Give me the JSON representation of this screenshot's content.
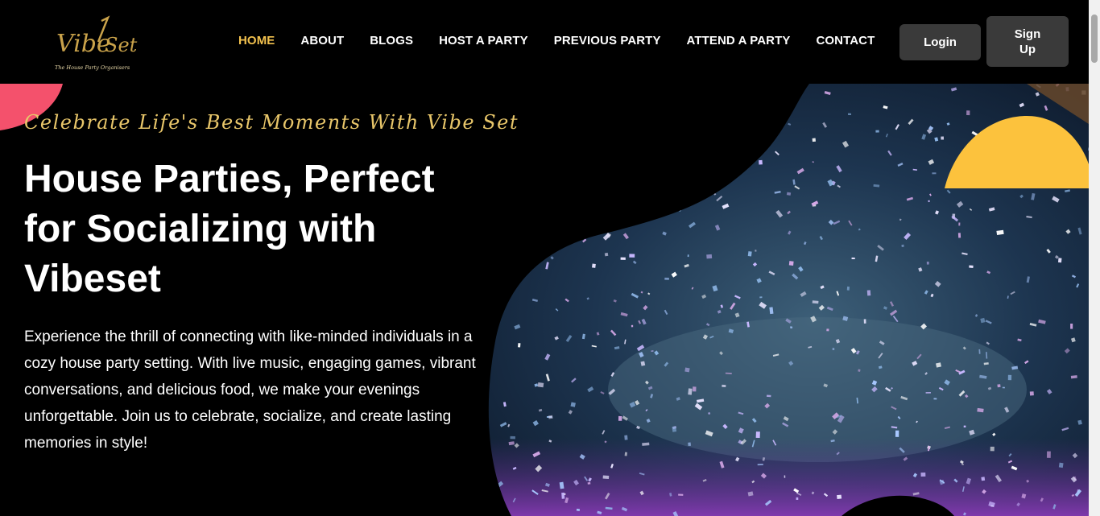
{
  "brand": {
    "logo_text": "VibeSet",
    "logo_tagline": "The House Party Organisers"
  },
  "nav": {
    "items": [
      {
        "label": "HOME",
        "active": true
      },
      {
        "label": "ABOUT",
        "active": false
      },
      {
        "label": "BLOGS",
        "active": false
      },
      {
        "label": "HOST A PARTY",
        "active": false
      },
      {
        "label": "PREVIOUS PARTY",
        "active": false
      },
      {
        "label": "ATTEND A PARTY",
        "active": false
      },
      {
        "label": "CONTACT",
        "active": false
      }
    ]
  },
  "auth": {
    "login_label": "Login",
    "signup_label": "Sign Up"
  },
  "hero": {
    "tagline": "Celebrate Life's Best Moments With Vibe Set",
    "headline": "House Parties, Perfect for Socializing with Vibeset",
    "description": "Experience the thrill of connecting with like-minded individuals in a cozy house party setting. With live music, engaging games, vibrant conversations, and delicious food, we make your evenings unforgettable. Join us to celebrate, socialize, and create lasting memories in style!",
    "image": "confetti-concert-photo"
  },
  "colors": {
    "accent": "#f2c14e",
    "button_bg": "#3a3a3a",
    "yellow_shape": "#fcc23d",
    "pink_shape": "#f4516c"
  }
}
